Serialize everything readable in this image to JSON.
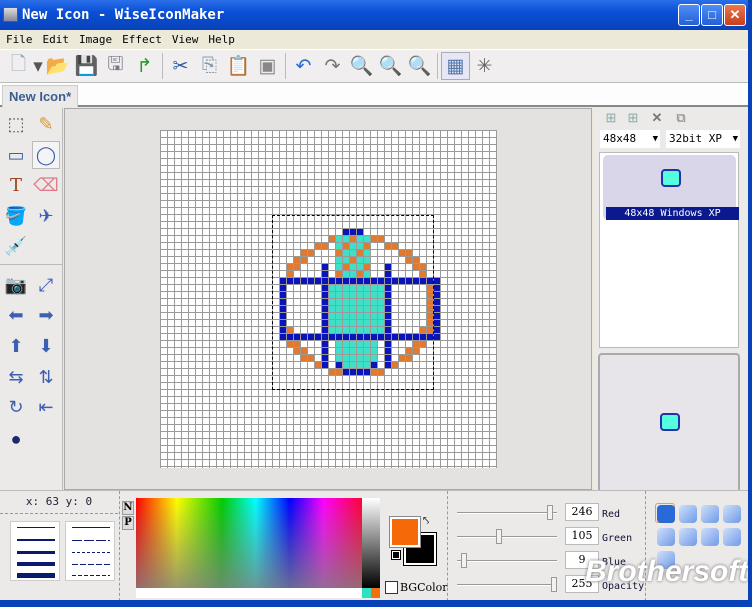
{
  "window": {
    "title": "New Icon - WiseIconMaker",
    "minimize": "_",
    "maximize": "□",
    "close": "✕"
  },
  "menu": [
    "File",
    "Edit",
    "Image",
    "Effect",
    "View",
    "Help"
  ],
  "toolbar": [
    {
      "name": "new-icon",
      "glyph": "🗋"
    },
    {
      "name": "new-dropdown-icon",
      "glyph": "▾"
    },
    {
      "name": "open-icon",
      "glyph": "📂"
    },
    {
      "name": "save-icon",
      "glyph": "💾"
    },
    {
      "name": "save-as-icon",
      "glyph": "🖫"
    },
    {
      "name": "export-icon",
      "glyph": "↱"
    },
    {
      "name": "cut-icon",
      "glyph": "✂"
    },
    {
      "name": "copy-icon",
      "glyph": "⎘"
    },
    {
      "name": "paste-icon",
      "glyph": "📋"
    },
    {
      "name": "paste-special-icon",
      "glyph": "▣"
    },
    {
      "name": "undo-icon",
      "glyph": "↶"
    },
    {
      "name": "redo-icon",
      "glyph": "↷"
    },
    {
      "name": "zoom-in-icon",
      "glyph": "🔍"
    },
    {
      "name": "zoom-out-icon",
      "glyph": "🔍"
    },
    {
      "name": "zoom-actual-icon",
      "glyph": "🔍"
    },
    {
      "name": "grid-icon",
      "glyph": "▦"
    },
    {
      "name": "effects-icon",
      "glyph": "✳"
    }
  ],
  "tab": {
    "label": "New Icon*"
  },
  "tools": [
    {
      "name": "select",
      "glyph": "⬚"
    },
    {
      "name": "pencil",
      "glyph": "✎"
    },
    {
      "name": "rectangle",
      "glyph": "▭"
    },
    {
      "name": "ellipse",
      "glyph": "◯"
    },
    {
      "name": "text",
      "glyph": "T"
    },
    {
      "name": "eraser",
      "glyph": "⌫"
    },
    {
      "name": "fill",
      "glyph": "🪣"
    },
    {
      "name": "spray",
      "glyph": "✈"
    },
    {
      "name": "eyedropper",
      "glyph": "💉"
    },
    {
      "name": "capture",
      "glyph": "📷"
    },
    {
      "name": "pick-color",
      "glyph": "⤢"
    },
    {
      "name": "shift-left",
      "glyph": "⬅"
    },
    {
      "name": "shift-right",
      "glyph": "➡"
    },
    {
      "name": "shift-up",
      "glyph": "⬆"
    },
    {
      "name": "shift-down",
      "glyph": "⬇"
    },
    {
      "name": "flip-horizontal",
      "glyph": "⇆"
    },
    {
      "name": "flip-vertical",
      "glyph": "⇅"
    },
    {
      "name": "rotate",
      "glyph": "↻"
    },
    {
      "name": "align-left",
      "glyph": "⇤"
    },
    {
      "name": "sphere",
      "glyph": "●"
    }
  ],
  "formats": {
    "size": "48x48",
    "depth": "32bit XP",
    "item_label": "48x48 Windows XP"
  },
  "status": {
    "coords": "x: 63  y: 0"
  },
  "palette": {
    "normal": "N",
    "pattern": "P",
    "bgcolor_label": "BGColor"
  },
  "colors": {
    "foreground": "#f66909",
    "background": "#000000",
    "accent": "#0842b8"
  },
  "rgba": {
    "red": {
      "label": "Red",
      "value": "246",
      "fraction": 0.96
    },
    "green": {
      "label": "Green",
      "value": "105",
      "fraction": 0.41
    },
    "blue": {
      "label": "Blue",
      "value": "9",
      "fraction": 0.04
    },
    "opacity": {
      "label": "Opacity",
      "value": "255",
      "fraction": 1.0
    }
  },
  "watermark": "Brothersoft"
}
